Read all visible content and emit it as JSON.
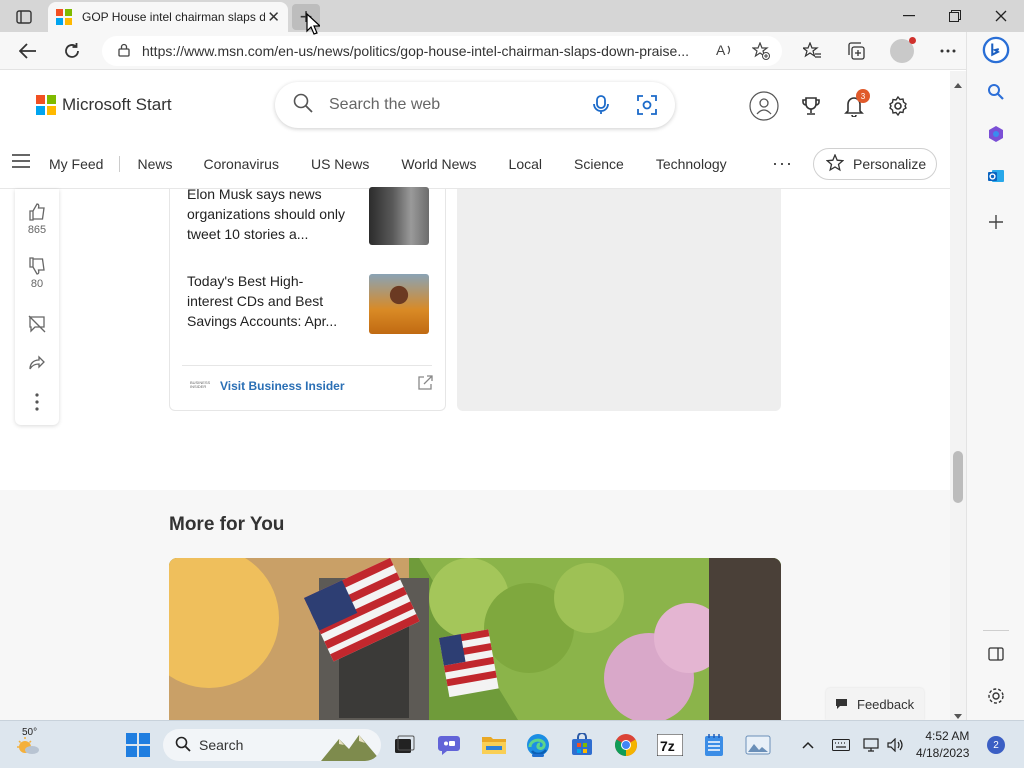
{
  "colors": {
    "ms_red": "#f25022",
    "ms_green": "#7fba00",
    "ms_blue": "#00a4ef",
    "ms_yellow": "#ffb900",
    "link_blue": "#2a6fb5",
    "notification_orange": "#e05a2b"
  },
  "browser": {
    "tab_title": "GOP House intel chairman slaps down praise",
    "tab_close": "✕",
    "new_tab": "+",
    "url": "https://www.msn.com/en-us/news/politics/gop-house-intel-chairman-slaps-down-praise..."
  },
  "header": {
    "brand": "Microsoft Start",
    "search_placeholder": "Search the web",
    "notification_count": "3"
  },
  "nav": {
    "items": [
      "My Feed",
      "News",
      "Coronavirus",
      "US News",
      "World News",
      "Local",
      "Science",
      "Technology"
    ],
    "more": "···",
    "personalize": "Personalize"
  },
  "reactions": {
    "likes": "865",
    "dislikes": "80"
  },
  "stories": [
    {
      "title": "Elon Musk says news organizations should only tweet 10 stories a..."
    },
    {
      "title": "Today's Best High-interest CDs and Best Savings Accounts: Apr..."
    }
  ],
  "publisher": {
    "visit_label": "Visit Business Insider",
    "logo_text": "BUSINESS INSIDER"
  },
  "more_section": {
    "title": "More for You"
  },
  "feedback": "Feedback",
  "taskbar": {
    "weather_temp": "50°",
    "search_label": "Search",
    "time": "4:52 AM",
    "date": "4/18/2023",
    "notification_count": "2"
  }
}
